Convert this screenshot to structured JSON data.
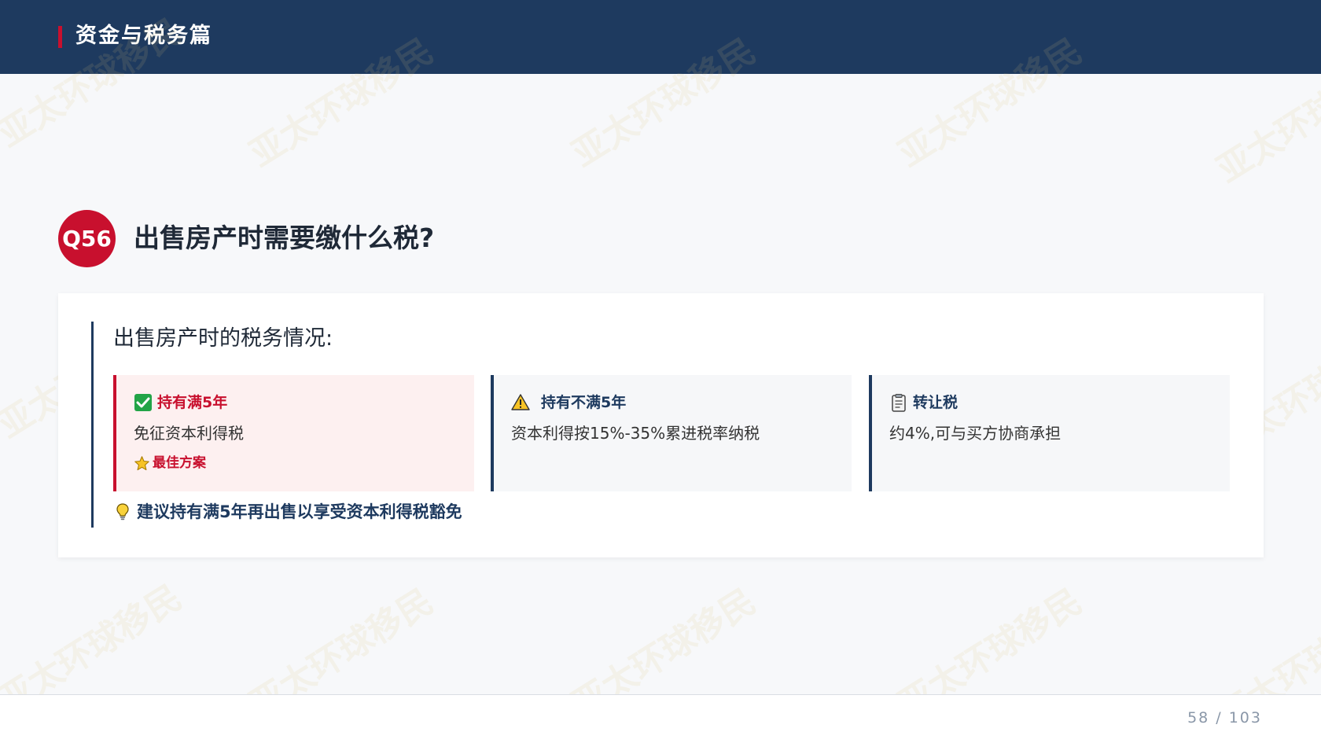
{
  "header": {
    "title": "资金与税务篇"
  },
  "watermark": {
    "text": "亚太环球移民"
  },
  "question": {
    "number": "Q56",
    "title": "出售房产时需要缴什么税?"
  },
  "card": {
    "subtitle": "出售房产时的税务情况:",
    "boxes": [
      {
        "icon": "check-icon",
        "title": "持有满5年",
        "body": "免征资本利得税",
        "tag": "最佳方案",
        "tag_icon": "star-icon"
      },
      {
        "icon": "warning-icon",
        "title": "持有不满5年",
        "body": "资本利得按15%-35%累进税率纳税"
      },
      {
        "icon": "clipboard-icon",
        "title": "转让税",
        "body": "约4%,可与买方协商承担"
      }
    ],
    "tip": {
      "icon": "lightbulb-icon",
      "text": "建议持有满5年再出售以享受资本利得税豁免"
    }
  },
  "footer": {
    "page": "58 / 103"
  },
  "colors": {
    "navy": "#1e3a5f",
    "red": "#c8102e",
    "background": "#f7f8fa"
  }
}
